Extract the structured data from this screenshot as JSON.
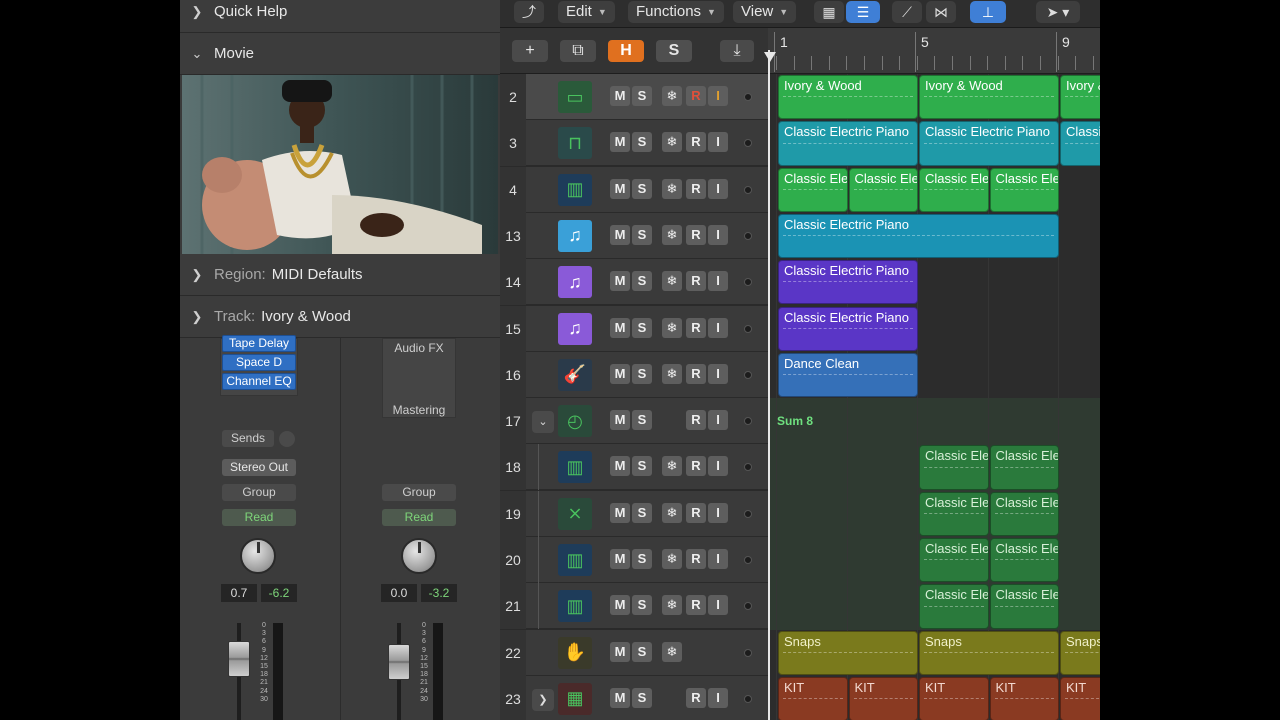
{
  "inspector": {
    "quick_help": "Quick Help",
    "movie": "Movie",
    "region_prefix": "Region:",
    "region_value": "MIDI Defaults",
    "track_prefix": "Track:",
    "track_value": "Ivory & Wood"
  },
  "strip1": {
    "plugins": [
      "Tape Delay",
      "Space D",
      "Channel EQ"
    ],
    "sends": "Sends",
    "output": "Stereo Out",
    "group": "Group",
    "automation": "Read",
    "pan_value": "0.7",
    "volume_value": "-6.2"
  },
  "strip2": {
    "audio_fx": "Audio FX",
    "mastering": "Mastering",
    "group": "Group",
    "automation": "Read",
    "pan_value": "0.0",
    "volume_value": "-3.2"
  },
  "fader_scale": [
    "0",
    "3",
    "6",
    "9",
    "12",
    "15",
    "18",
    "21",
    "24",
    "30"
  ],
  "control_bar": {
    "edit": "Edit",
    "functions": "Functions",
    "view": "View"
  },
  "header_bar": {
    "add": "+",
    "h": "H",
    "s": "S"
  },
  "ruler": {
    "bars": [
      "1",
      "5",
      "9"
    ]
  },
  "tracks": [
    {
      "num": "2",
      "icon": "piano-icon",
      "freeze": true,
      "rec": true
    },
    {
      "num": "3",
      "icon": "electric-piano-icon",
      "freeze": true,
      "rec": true
    },
    {
      "num": "4",
      "icon": "synth-keyboard-icon",
      "freeze": true,
      "rec": true
    },
    {
      "num": "13",
      "icon": "music-note-icon",
      "freeze": true,
      "rec": true
    },
    {
      "num": "14",
      "icon": "music-note-icon",
      "freeze": true,
      "rec": true
    },
    {
      "num": "15",
      "icon": "music-note-icon",
      "freeze": true,
      "rec": true
    },
    {
      "num": "16",
      "icon": "guitar-icon",
      "freeze": true,
      "rec": true
    },
    {
      "num": "17",
      "icon": "summing-stack-icon",
      "freeze": false,
      "rec": true
    },
    {
      "num": "18",
      "icon": "synth-keyboard-icon",
      "freeze": true,
      "rec": true
    },
    {
      "num": "19",
      "icon": "keyboard-stand-icon",
      "freeze": true,
      "rec": true
    },
    {
      "num": "20",
      "icon": "synth-keyboard-icon",
      "freeze": true,
      "rec": true
    },
    {
      "num": "21",
      "icon": "synth-keyboard-icon",
      "freeze": true,
      "rec": true
    },
    {
      "num": "22",
      "icon": "hand-clap-icon",
      "freeze": true,
      "rec": false
    },
    {
      "num": "23",
      "icon": "drum-machine-icon",
      "freeze": false,
      "rec": true
    }
  ],
  "track_buttons": {
    "m": "M",
    "s": "S",
    "r": "R",
    "i": "I",
    "freeze": "❄"
  },
  "regions": {
    "ivory": "Ivory & Wood",
    "cep": "Classic Electric Piano",
    "cep_short": "Classic Ele",
    "cep_cut": "Classic",
    "ivory_cut": "Ivory &",
    "dance": "Dance Clean",
    "sum": "Sum 8",
    "snaps": "Snaps",
    "kit": "KIT"
  },
  "colors": {
    "green": "#2fae4c",
    "teal": "#1f9aa8",
    "cyan": "#1b93b4",
    "purple": "#5a36c6",
    "blue": "#3570b8",
    "dark_green": "#2a7a3c",
    "olive": "#7a7a1c",
    "brown": "#8a3a22",
    "accent_blue": "#3f7fd6",
    "orange": "#e0701f"
  }
}
